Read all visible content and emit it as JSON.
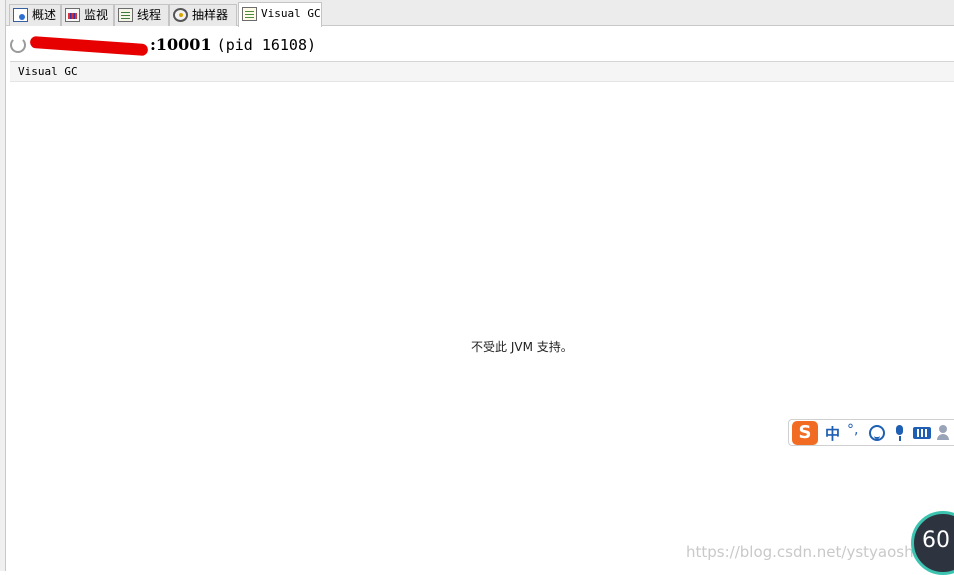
{
  "tabs": [
    {
      "label": "概述",
      "icon": "overview-icon"
    },
    {
      "label": "监视",
      "icon": "monitor-icon"
    },
    {
      "label": "线程",
      "icon": "threads-icon"
    },
    {
      "label": "抽样器",
      "icon": "sampler-icon"
    },
    {
      "label": "Visual GC",
      "icon": "visual-gc-icon",
      "active": true
    }
  ],
  "header": {
    "host_suffix": ":10001",
    "pid": "(pid 16108)"
  },
  "subtoolbar": {
    "label": "Visual GC"
  },
  "main": {
    "message": "不受此 JVM 支持。"
  },
  "ime_toolbar": {
    "logo": "S",
    "mode": "中",
    "punctuation": "°,"
  },
  "watermark": "https://blog.csdn.net/ystyaoshengting",
  "gauge": {
    "value": "60"
  },
  "colors": {
    "redaction": "#e60000",
    "ime_brand": "#f26b22",
    "ime_icon": "#1e5fb3",
    "gauge_ring": "#3cc4b0"
  }
}
